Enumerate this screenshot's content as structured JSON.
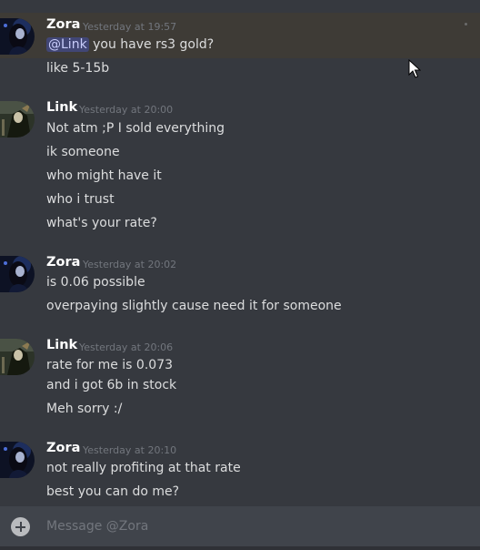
{
  "composer": {
    "placeholder": "Message @Zora"
  },
  "messages": [
    {
      "author": "Zora",
      "time": "Yesterday at 19:57",
      "mention": "@Link",
      "lines": [
        " you have rs3 gold?",
        "like 5-15b"
      ]
    },
    {
      "author": "Link",
      "time": "Yesterday at 20:00",
      "lines": [
        "Not atm ;P I sold everything",
        "ik someone",
        "who might have it",
        "who i trust",
        "what's your rate?"
      ]
    },
    {
      "author": "Zora",
      "time": "Yesterday at 20:02",
      "lines": [
        "is 0.06 possible",
        "overpaying slightly cause need it for someone"
      ]
    },
    {
      "author": "Link",
      "time": "Yesterday at 20:06",
      "lines": [
        "rate for me is 0.073",
        "and i got 6b in stock",
        "Meh sorry :/"
      ]
    },
    {
      "author": "Zora",
      "time": "Yesterday at 20:10",
      "lines": [
        "not really profiting at that rate",
        "best you can do me?"
      ]
    }
  ],
  "colors": {
    "background": "#36393f",
    "mention_bg": "#414675",
    "username": "#ffffff",
    "timestamp": "#72767d"
  },
  "icons": [
    "add-attachment-icon",
    "mouse-cursor-icon"
  ]
}
